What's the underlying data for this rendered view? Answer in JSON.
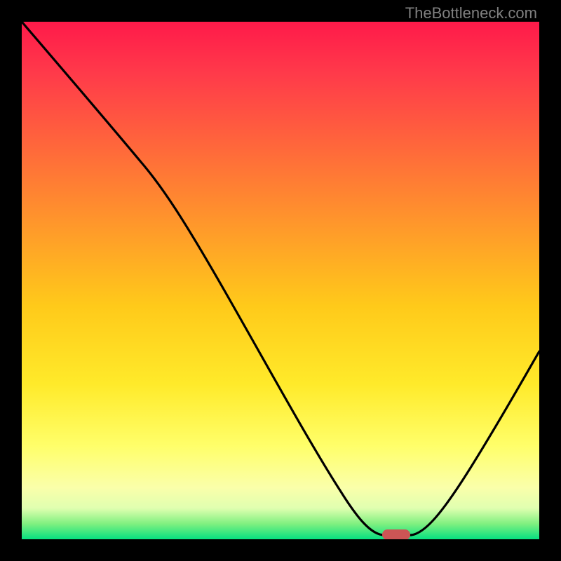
{
  "watermark": "TheBottleneck.com",
  "chart_data": {
    "type": "line",
    "title": "",
    "xlabel": "",
    "ylabel": "",
    "x_range": [
      0,
      100
    ],
    "y_range": [
      0,
      100
    ],
    "series": [
      {
        "name": "bottleneck-curve",
        "points": [
          {
            "x": 0,
            "y": 100
          },
          {
            "x": 12,
            "y": 86
          },
          {
            "x": 22,
            "y": 74
          },
          {
            "x": 30,
            "y": 62
          },
          {
            "x": 40,
            "y": 44
          },
          {
            "x": 50,
            "y": 27
          },
          {
            "x": 58,
            "y": 12
          },
          {
            "x": 62,
            "y": 4
          },
          {
            "x": 66,
            "y": 0.5
          },
          {
            "x": 72,
            "y": 0.5
          },
          {
            "x": 78,
            "y": 6
          },
          {
            "x": 86,
            "y": 18
          },
          {
            "x": 94,
            "y": 30
          },
          {
            "x": 100,
            "y": 40
          }
        ]
      }
    ],
    "marker": {
      "x": 70,
      "y": 0.5,
      "color": "#d04848",
      "shape": "capsule"
    },
    "colors": {
      "background_top": "#ff1a4a",
      "background_bottom": "#06e080",
      "curve": "#000000",
      "frame": "#000000"
    }
  }
}
